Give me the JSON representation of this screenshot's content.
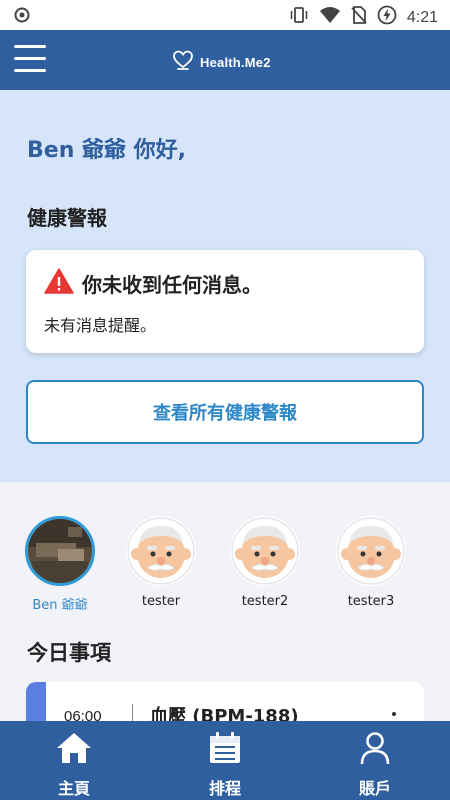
{
  "status_bar": {
    "time": "4:21",
    "icons": [
      "record-icon",
      "vibrate-icon",
      "wifi-icon",
      "no-sim-icon",
      "battery-charging-icon"
    ]
  },
  "app_bar": {
    "brand": "Health.Me2",
    "icons": [
      "menu-icon",
      "heart-hand-logo-icon"
    ]
  },
  "greeting": "Ben 爺爺 你好,",
  "alerts": {
    "section_title": "健康警報",
    "card_title": "你未收到任何消息。",
    "card_subtitle": "未有消息提醒。",
    "warning_icon": "warning-icon",
    "warning_color": "#e53935",
    "view_all_label": "查看所有健康警報"
  },
  "people": [
    {
      "name": "Ben 爺爺",
      "selected": true
    },
    {
      "name": "tester",
      "selected": false
    },
    {
      "name": "tester2",
      "selected": false
    },
    {
      "name": "tester3",
      "selected": false
    }
  ],
  "today": {
    "title": "今日事項",
    "events": [
      {
        "time": "06:00",
        "title": "血壓 (BPM-188)",
        "color": "#5b7fe0"
      }
    ]
  },
  "bottom_nav": [
    {
      "label": "主頁",
      "icon": "home-icon"
    },
    {
      "label": "排程",
      "icon": "calendar-icon"
    },
    {
      "label": "賬戶",
      "icon": "person-icon"
    }
  ],
  "colors": {
    "primary": "#2f5f9e",
    "hero_bg": "#d6e5f9",
    "accent": "#2e88c8",
    "page_bg": "#f1f3f8"
  }
}
